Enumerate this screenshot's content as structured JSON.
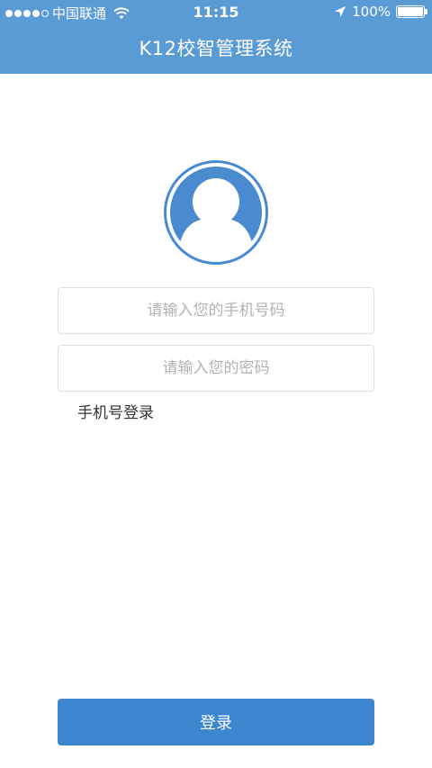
{
  "status_bar": {
    "carrier": "中国联通",
    "time": "11:15",
    "battery": "100%"
  },
  "nav": {
    "title": "K12校智管理系统"
  },
  "form": {
    "phone_placeholder": "请输入您的手机号码",
    "password_placeholder": "请输入您的密码",
    "phone_login_link": "手机号登录",
    "login_button": "登录"
  },
  "colors": {
    "header_bg": "#5b9bd5",
    "avatar_bg": "#4a8bd0",
    "button_bg": "#3b86cf"
  }
}
